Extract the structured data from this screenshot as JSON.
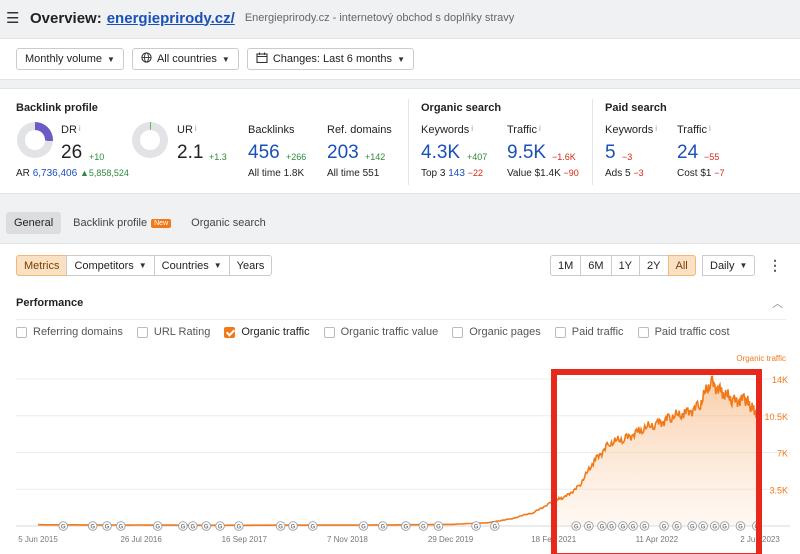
{
  "header": {
    "overview_label": "Overview:",
    "domain": "energieprirody.cz/",
    "description": "Energieprirody.cz - internetový obchod s doplňky stravy"
  },
  "filters": {
    "volume": "Monthly volume",
    "countries": "All countries",
    "changes": "Changes: Last 6 months"
  },
  "backlink_profile": {
    "title": "Backlink profile",
    "dr": {
      "label": "DR",
      "value": "26",
      "delta": "+10",
      "donut_fraction": 0.26
    },
    "ar": {
      "label": "AR",
      "value": "6,736,406",
      "delta": "5,858,524"
    },
    "ur": {
      "label": "UR",
      "value": "2.1",
      "delta": "+1.3",
      "donut_fraction": 0.021
    },
    "backlinks": {
      "label": "Backlinks",
      "value": "456",
      "delta": "+266",
      "sub_label": "All time",
      "sub_value": "1.8K"
    },
    "ref_domains": {
      "label": "Ref. domains",
      "value": "203",
      "delta": "+142",
      "sub_label": "All time",
      "sub_value": "551"
    }
  },
  "organic_search": {
    "title": "Organic search",
    "keywords": {
      "label": "Keywords",
      "value": "4.3K",
      "delta": "+407",
      "sub_label": "Top 3",
      "sub_value": "143",
      "sub_delta": "−22"
    },
    "traffic": {
      "label": "Traffic",
      "value": "9.5K",
      "delta": "−1.6K",
      "sub_label": "Value",
      "sub_value": "$1.4K",
      "sub_delta": "−90"
    }
  },
  "paid_search": {
    "title": "Paid search",
    "keywords": {
      "label": "Keywords",
      "value": "5",
      "delta": "−3",
      "sub_label": "Ads",
      "sub_value": "5",
      "sub_delta": "−3"
    },
    "traffic": {
      "label": "Traffic",
      "value": "24",
      "delta": "−55",
      "sub_label": "Cost",
      "sub_value": "$1",
      "sub_delta": "−7"
    }
  },
  "tabs": {
    "general": "General",
    "backlink_profile": "Backlink profile",
    "new_badge": "New",
    "organic_search": "Organic search"
  },
  "controls": {
    "metrics": "Metrics",
    "competitors": "Competitors",
    "countries": "Countries",
    "years": "Years",
    "ranges": [
      "1M",
      "6M",
      "1Y",
      "2Y",
      "All"
    ],
    "granularity": "Daily"
  },
  "performance": {
    "title": "Performance",
    "checkboxes": [
      {
        "label": "Referring domains",
        "checked": false
      },
      {
        "label": "URL Rating",
        "checked": false
      },
      {
        "label": "Organic traffic",
        "checked": true
      },
      {
        "label": "Organic traffic value",
        "checked": false
      },
      {
        "label": "Organic pages",
        "checked": false
      },
      {
        "label": "Paid traffic",
        "checked": false
      },
      {
        "label": "Paid traffic cost",
        "checked": false
      }
    ]
  },
  "colors": {
    "accent": "#f07a1a",
    "link_blue": "#1a50b8",
    "positive": "#2e8a3d",
    "negative": "#d4281b",
    "highlight_box": "#e8281a"
  },
  "chart_data": {
    "type": "area",
    "series": [
      {
        "name": "Organic traffic",
        "x": [
          "2015-06-05",
          "2016-01-01",
          "2016-07-26",
          "2017-01-01",
          "2017-09-16",
          "2018-01-01",
          "2018-11-07",
          "2019-06-01",
          "2019-12-29",
          "2020-06-01",
          "2020-09-01",
          "2020-12-01",
          "2021-02-18",
          "2021-04-01",
          "2021-06-01",
          "2021-08-01",
          "2021-10-01",
          "2021-12-01",
          "2022-02-01",
          "2022-04-11",
          "2022-06-01",
          "2022-08-01",
          "2022-10-01",
          "2022-11-15",
          "2023-01-01",
          "2023-02-15",
          "2023-04-01",
          "2023-05-01",
          "2023-06-02"
        ],
        "y": [
          120,
          100,
          90,
          80,
          70,
          80,
          90,
          110,
          150,
          320,
          700,
          1300,
          2400,
          2700,
          3800,
          6200,
          7900,
          8300,
          9100,
          9700,
          10300,
          10700,
          11500,
          13800,
          12700,
          11900,
          12100,
          11200,
          10600
        ]
      }
    ],
    "x_tick_labels": [
      "5 Jun 2015",
      "26 Jul 2016",
      "16 Sep 2017",
      "7 Nov 2018",
      "29 Dec 2019",
      "18 Feb 2021",
      "11 Apr 2022",
      "2 Jun 2023"
    ],
    "y_tick_labels": [
      "14K",
      "10.5K",
      "7K",
      "3.5K"
    ],
    "y_ticks": [
      14000,
      10500,
      7000,
      3500
    ],
    "ylim": [
      0,
      14000
    ],
    "xlim": [
      "2015-06-05",
      "2023-06-02"
    ],
    "axis_title": "Organic traffic",
    "axis_position": "right",
    "grid": true,
    "annotation_markers": [
      "2015-09-15",
      "2016-01-12",
      "2016-03-10",
      "2016-05-05",
      "2016-10-01",
      "2017-01-11",
      "2017-02-20",
      "2017-04-15",
      "2017-06-10",
      "2017-08-25",
      "2018-02-10",
      "2018-04-01",
      "2018-06-20",
      "2019-01-11",
      "2019-03-30",
      "2019-07-01",
      "2019-09-10",
      "2019-11-10",
      "2020-04-10",
      "2020-06-25",
      "2021-05-20",
      "2021-07-10",
      "2021-09-01",
      "2021-10-10",
      "2021-11-25",
      "2022-01-05",
      "2022-02-20",
      "2022-05-10",
      "2022-07-01",
      "2022-09-01",
      "2022-10-15",
      "2022-12-01",
      "2023-01-10",
      "2023-03-15",
      "2023-05-20"
    ],
    "annotation_marker_label": "G"
  }
}
